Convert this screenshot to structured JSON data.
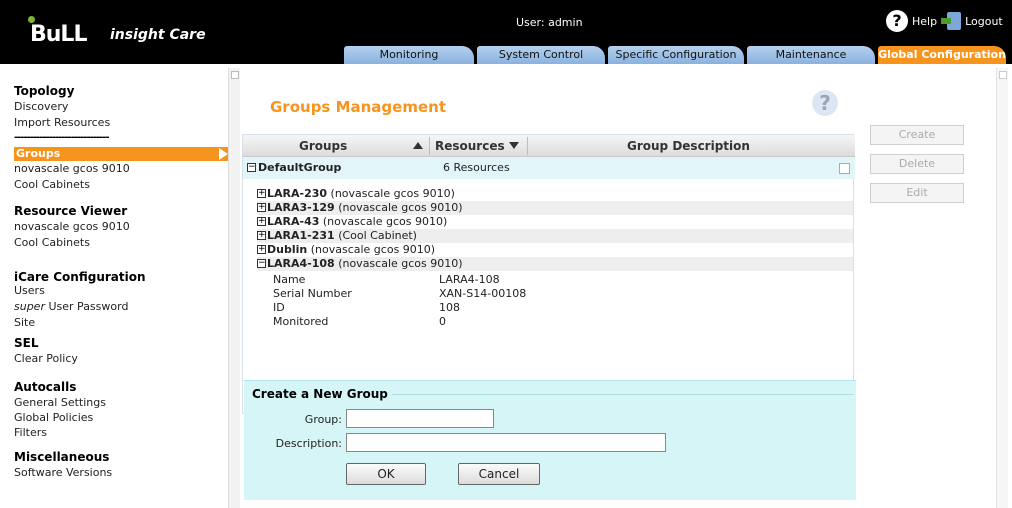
{
  "header": {
    "brand": "BuLL",
    "product": "insight Care",
    "user_label": "User: admin",
    "help_label": "Help",
    "logout_label": "Logout",
    "tabs": [
      {
        "label": "Monitoring",
        "active": false
      },
      {
        "label": "System Control",
        "active": false
      },
      {
        "label": "Specific Configuration",
        "active": false
      },
      {
        "label": "Maintenance",
        "active": false
      },
      {
        "label": "Global Configuration",
        "active": true
      }
    ],
    "accent": "#f7941d"
  },
  "sidebar": {
    "topology": "Topology",
    "discovery": "Discovery",
    "import_resources": "Import Resources",
    "separator": "------------------------------",
    "groups": "Groups",
    "novascale_1": "novascale gcos 9010",
    "cool_1": "Cool Cabinets",
    "resource_viewer": "Resource Viewer",
    "novascale_2": "novascale gcos 9010",
    "cool_2": "Cool Cabinets",
    "icare_config": "iCare Configuration",
    "users": "Users",
    "super_word": "super",
    "super_rest": " User Password",
    "site": "Site",
    "sel": "SEL",
    "clear_policy": "Clear Policy",
    "autocalls": "Autocalls",
    "general_settings": "General Settings",
    "global_policies": "Global Policies",
    "filters": "Filters",
    "miscellaneous": "Miscellaneous",
    "software_versions": "Software Versions"
  },
  "main": {
    "title": "Groups Management",
    "buttons": {
      "create": "Create",
      "delete": "Delete",
      "edit": "Edit"
    },
    "columns": {
      "groups": "Groups",
      "resources": "Resources",
      "description": "Group Description"
    },
    "default_group": {
      "name": "DefaultGroup",
      "resources": "6 Resources"
    },
    "resources": [
      {
        "name": "LARA-230",
        "type": "(novascale gcos 9010)",
        "expanded": false
      },
      {
        "name": "LARA3-129",
        "type": "(novascale gcos 9010)",
        "expanded": false
      },
      {
        "name": "LARA-43",
        "type": "(novascale gcos 9010)",
        "expanded": false
      },
      {
        "name": "LARA1-231",
        "type": "(Cool Cabinet)",
        "expanded": false
      },
      {
        "name": "Dublin",
        "type": "(novascale gcos 9010)",
        "expanded": false
      },
      {
        "name": "LARA4-108",
        "type": "(novascale gcos 9010)",
        "expanded": true
      }
    ],
    "details": {
      "name_label": "Name",
      "name_value": "LARA4-108",
      "serial_label": "Serial Number",
      "serial_value": "XAN-S14-00108",
      "id_label": "ID",
      "id_value": "108",
      "monitored_label": "Monitored",
      "monitored_value": "0"
    }
  },
  "form": {
    "title": "Create a New Group",
    "group_label": "Group:",
    "group_value": "",
    "description_label": "Description:",
    "description_value": "",
    "ok": "OK",
    "cancel": "Cancel"
  }
}
